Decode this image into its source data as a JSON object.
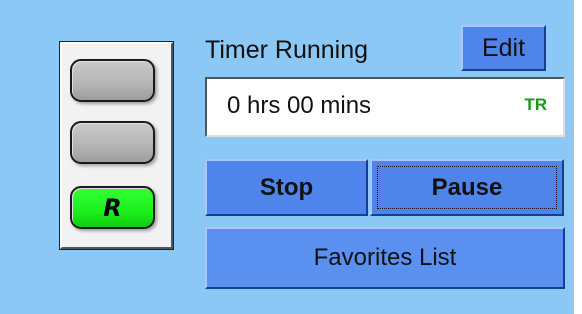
{
  "timer": {
    "status_label": "Timer Running",
    "edit_label": "Edit",
    "elapsed": "0 hrs 00 mins",
    "mode_badge": "TR",
    "mode_badge_color": "#1a9a1a"
  },
  "controls": {
    "stop_label": "Stop",
    "pause_label": "Pause",
    "favorites_label": "Favorites List"
  },
  "indicator": {
    "lamps": [
      {
        "state": "off",
        "color": "#b4b4b4",
        "letter": ""
      },
      {
        "state": "off",
        "color": "#b4b4b4",
        "letter": ""
      },
      {
        "state": "on",
        "color": "#1cf01c",
        "letter": "R"
      }
    ]
  },
  "colors": {
    "panel_background": "#8cc8f5",
    "button_blue": "#4f84ea",
    "active_lamp_green": "#1cf01c"
  }
}
